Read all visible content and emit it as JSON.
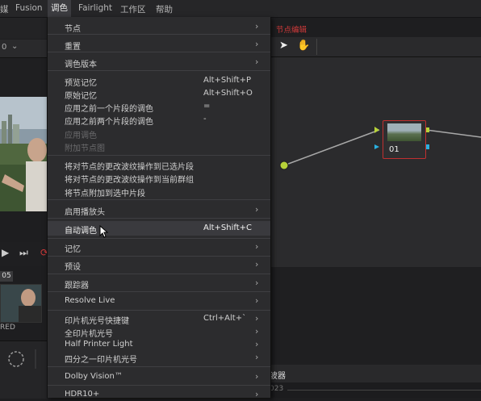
{
  "menubar": {
    "items": [
      "媒",
      "Fusion",
      "调色",
      "Fairlight",
      "工作区",
      "帮助"
    ],
    "active_index": 2
  },
  "left_panel": {
    "selector_value": "0",
    "clip_number": "05",
    "clip_label": "RED"
  },
  "node_editor": {
    "title": "节点编辑",
    "node_label": "01"
  },
  "scopes": {
    "tab_label": "波器",
    "timecode": "023"
  },
  "menu": {
    "items": [
      {
        "label": "节点",
        "submenu": true
      },
      {
        "label": "重置",
        "submenu": true
      },
      {
        "label": "调色版本",
        "submenu": true
      },
      {
        "label": "预览记忆",
        "shortcut": "Alt+Shift+P"
      },
      {
        "label": "原始记忆",
        "shortcut": "Alt+Shift+O"
      },
      {
        "label": "应用之前一个片段的调色",
        "shortcut": "="
      },
      {
        "label": "应用之前两个片段的调色",
        "shortcut": "-"
      },
      {
        "label": "应用调色",
        "disabled": true
      },
      {
        "label": "附加节点图",
        "disabled": true
      },
      {
        "label": "将对节点的更改波纹操作到已选片段"
      },
      {
        "label": "将对节点的更改波纹操作到当前群组"
      },
      {
        "label": "将节点附加到选中片段"
      },
      {
        "label": "启用播放头",
        "submenu": true
      },
      {
        "label": "自动调色",
        "shortcut": "Alt+Shift+C",
        "highlighted": true
      },
      {
        "label": "记忆",
        "submenu": true
      },
      {
        "label": "预设",
        "submenu": true
      },
      {
        "label": "跟踪器",
        "submenu": true
      },
      {
        "label": "Resolve Live",
        "submenu": true
      },
      {
        "label": "印片机光号快捷键",
        "shortcut": "Ctrl+Alt+`",
        "submenu": true
      },
      {
        "label": "全印片机光号",
        "submenu": true
      },
      {
        "label": "Half Printer Light",
        "submenu": true
      },
      {
        "label": "四分之一印片机光号",
        "submenu": true
      },
      {
        "label": "Dolby Vision™",
        "submenu": true
      },
      {
        "label": "HDR10+",
        "submenu": true
      }
    ],
    "arrow_glyph": "›"
  }
}
